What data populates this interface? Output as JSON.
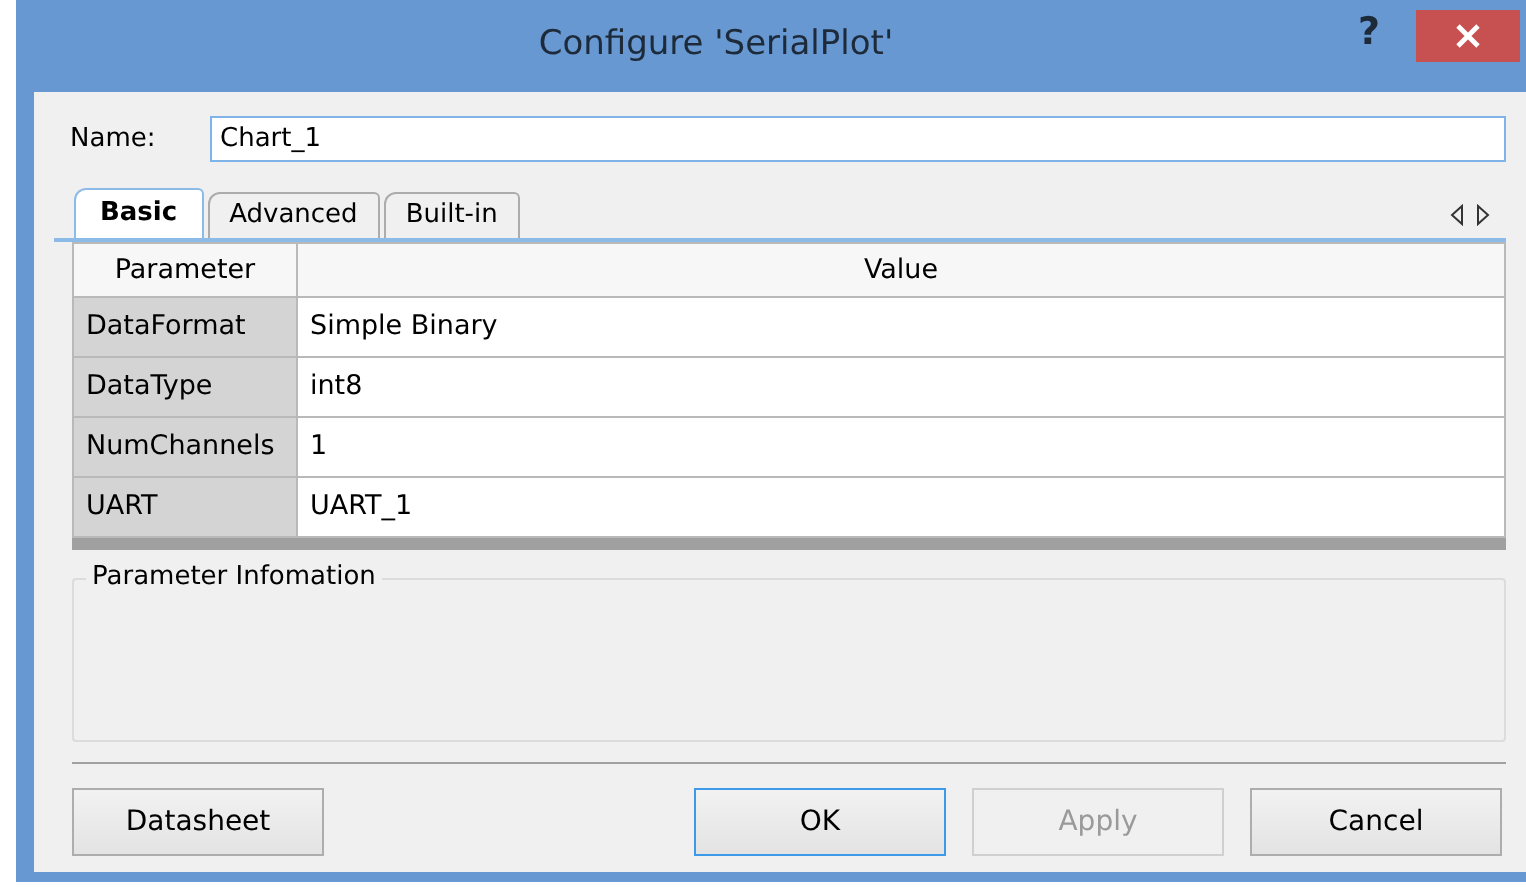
{
  "window": {
    "title": "Configure 'SerialPlot'",
    "help": "?"
  },
  "name_field": {
    "label": "Name:",
    "value": "Chart_1"
  },
  "tabs": [
    {
      "label": "Basic",
      "selected": true
    },
    {
      "label": "Advanced",
      "selected": false
    },
    {
      "label": "Built-in",
      "selected": false
    }
  ],
  "table": {
    "columns": [
      "Parameter",
      "Value"
    ],
    "rows": [
      [
        "DataFormat",
        "Simple Binary"
      ],
      [
        "DataType",
        "int8"
      ],
      [
        "NumChannels",
        "1"
      ],
      [
        "UART",
        "UART_1"
      ]
    ]
  },
  "info_group": {
    "title": "Parameter Infomation"
  },
  "buttons": [
    {
      "label": "Datasheet",
      "default": false,
      "disabled": false
    },
    {
      "label": "OK",
      "default": true,
      "disabled": false
    },
    {
      "label": "Apply",
      "default": false,
      "disabled": true
    },
    {
      "label": "Cancel",
      "default": false,
      "disabled": false
    }
  ]
}
